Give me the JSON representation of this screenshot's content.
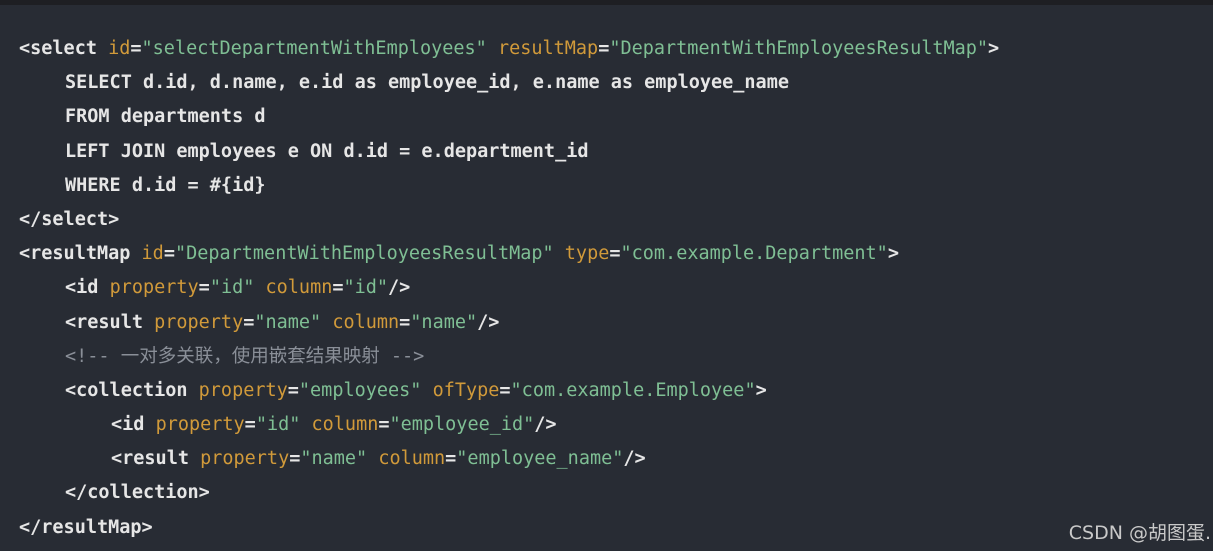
{
  "lines": {
    "l1": {
      "open": "<select ",
      "a1": "id",
      "eq1": "=",
      "v1": "\"selectDepartmentWithEmployees\"",
      "sp": " ",
      "a2": "resultMap",
      "eq2": "=",
      "v2": "\"DepartmentWithEmployeesResultMap\"",
      "close": ">"
    },
    "l2": {
      "text": "SELECT d.id, d.name, e.id as employee_id, e.name as employee_name"
    },
    "l3": {
      "text": "FROM departments d"
    },
    "l4": {
      "text": "LEFT JOIN employees e ON d.id = e.department_id"
    },
    "l5": {
      "text": "WHERE d.id = #{id}"
    },
    "l6": {
      "text": "</select>"
    },
    "l7": {
      "open": "<resultMap ",
      "a1": "id",
      "eq1": "=",
      "v1": "\"DepartmentWithEmployeesResultMap\"",
      "sp": " ",
      "a2": "type",
      "eq2": "=",
      "v2": "\"com.example.Department\"",
      "close": ">"
    },
    "l8": {
      "open": "<id ",
      "a1": "property",
      "eq1": "=",
      "v1": "\"id\"",
      "sp": " ",
      "a2": "column",
      "eq2": "=",
      "v2": "\"id\"",
      "close": "/>"
    },
    "l9": {
      "open": "<result ",
      "a1": "property",
      "eq1": "=",
      "v1": "\"name\"",
      "sp": " ",
      "a2": "column",
      "eq2": "=",
      "v2": "\"name\"",
      "close": "/>"
    },
    "l10": {
      "text": "<!-- 一对多关联，使用嵌套结果映射 -->"
    },
    "l11": {
      "open": "<collection ",
      "a1": "property",
      "eq1": "=",
      "v1": "\"employees\"",
      "sp": " ",
      "a2": "ofType",
      "eq2": "=",
      "v2": "\"com.example.Employee\"",
      "close": ">"
    },
    "l12": {
      "open": "<id ",
      "a1": "property",
      "eq1": "=",
      "v1": "\"id\"",
      "sp": " ",
      "a2": "column",
      "eq2": "=",
      "v2": "\"employee_id\"",
      "close": "/>"
    },
    "l13": {
      "open": "<result ",
      "a1": "property",
      "eq1": "=",
      "v1": "\"name\"",
      "sp": " ",
      "a2": "column",
      "eq2": "=",
      "v2": "\"employee_name\"",
      "close": "/>"
    },
    "l14": {
      "text": "</collection>"
    },
    "l15": {
      "text": "</resultMap>"
    }
  },
  "watermark": "CSDN @胡图蛋.",
  "colors": {
    "background": "#282c34",
    "tag_text": "#e6e6e6",
    "attribute": "#d19a3a",
    "string_value": "#7fbf94",
    "comment": "#8a8f98"
  }
}
